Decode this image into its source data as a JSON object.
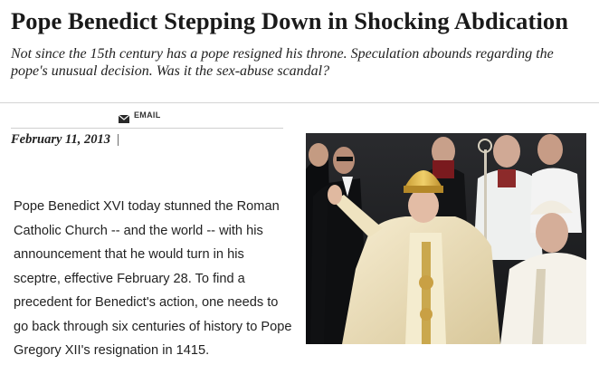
{
  "article": {
    "headline": "Pope Benedict Stepping Down in Shocking Abdication",
    "dek": "Not since the 15th century has a pope resigned his throne. Speculation abounds regarding the pope's unusual decision. Was it the sex-abuse scandal?",
    "email_label": "EMAIL",
    "email_icon": "envelope-icon",
    "date": "February 11, 2013",
    "date_separator": "|",
    "body": "Pope Benedict XVI today stunned the Roman Catholic Church -- and the world -- with his announcement that he would turn in his sceptre, effective February 28. To find a precedent for Benedict's action, one needs to go back through six centuries of history to Pope Gregory XII's resignation in 1415."
  },
  "colors": {
    "photo_background": "#1b1d20",
    "vestment_cream": "#efe3c0",
    "mitre_gold": "#d9b24a",
    "rule_gray": "#d4d4d4"
  }
}
